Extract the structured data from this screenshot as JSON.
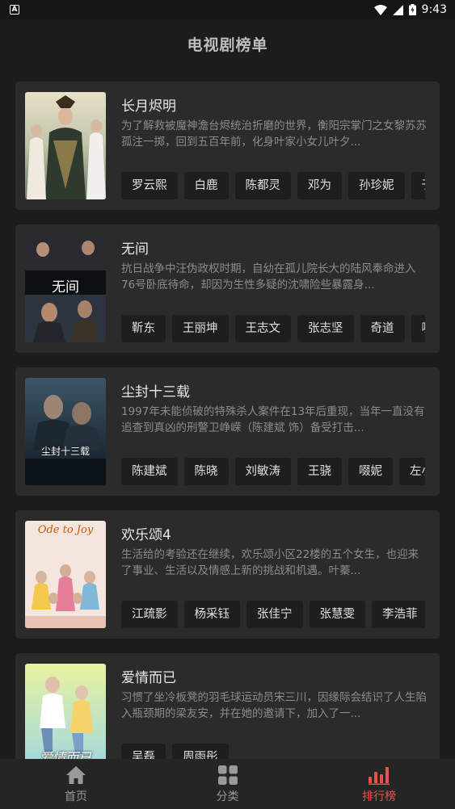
{
  "status_bar": {
    "time": "9:43",
    "app_badge": "A"
  },
  "header": {
    "title": "电视剧榜单"
  },
  "dramas": [
    {
      "title": "长月烬明",
      "description": "为了解救被魔神澹台烬统治折磨的世界，衡阳宗掌门之女黎苏苏孤注一掷，回到五百年前，化身叶家小女儿叶夕...",
      "cast": [
        "罗云熙",
        "白鹿",
        "陈都灵",
        "邓为",
        "孙珍妮",
        "于"
      ]
    },
    {
      "title": "无间",
      "description": "抗日战争中汪伪政权时期，自幼在孤儿院长大的陆风奉命进入76号卧底待命，却因为生性多疑的沈啸险些暴露身...",
      "cast": [
        "靳东",
        "王丽坤",
        "王志文",
        "张志坚",
        "奇道",
        "啜"
      ]
    },
    {
      "title": "尘封十三载",
      "description": "1997年未能侦破的特殊杀人案件在13年后重现，当年一直没有追查到真凶的刑警卫峥嵘（陈建斌 饰）备受打击...",
      "cast": [
        "陈建斌",
        "陈晓",
        "刘敏涛",
        "王骁",
        "啜妮",
        "左小"
      ]
    },
    {
      "title": "欢乐颂4",
      "description": "生活给的考验还在继续，欢乐颂小区22楼的五个女生，也迎来了事业、生活以及情感上新的挑战和机遇。叶蓁...",
      "cast": [
        "江疏影",
        "杨采钰",
        "张佳宁",
        "张慧雯",
        "李浩菲"
      ]
    },
    {
      "title": "爱情而已",
      "description": "习惯了坐冷板凳的羽毛球运动员宋三川，因缘际会结识了人生陷入瓶颈期的梁友安，并在她的邀请下，加入了一...",
      "cast": [
        "吴磊",
        "周雨彤"
      ]
    }
  ],
  "posters": {
    "p2_text": "无间",
    "p3_text": "尘封十三载",
    "p4_text": "Ode to Joy",
    "p5_text": "爱情而已"
  },
  "bottom_nav": [
    {
      "label": "首页",
      "icon": "home-icon"
    },
    {
      "label": "分类",
      "icon": "grid-icon"
    },
    {
      "label": "排行榜",
      "icon": "bar-chart-icon"
    }
  ],
  "colors": {
    "accent": "#e8524a",
    "background": "#1c1c1c",
    "card": "#2b2b2b"
  }
}
